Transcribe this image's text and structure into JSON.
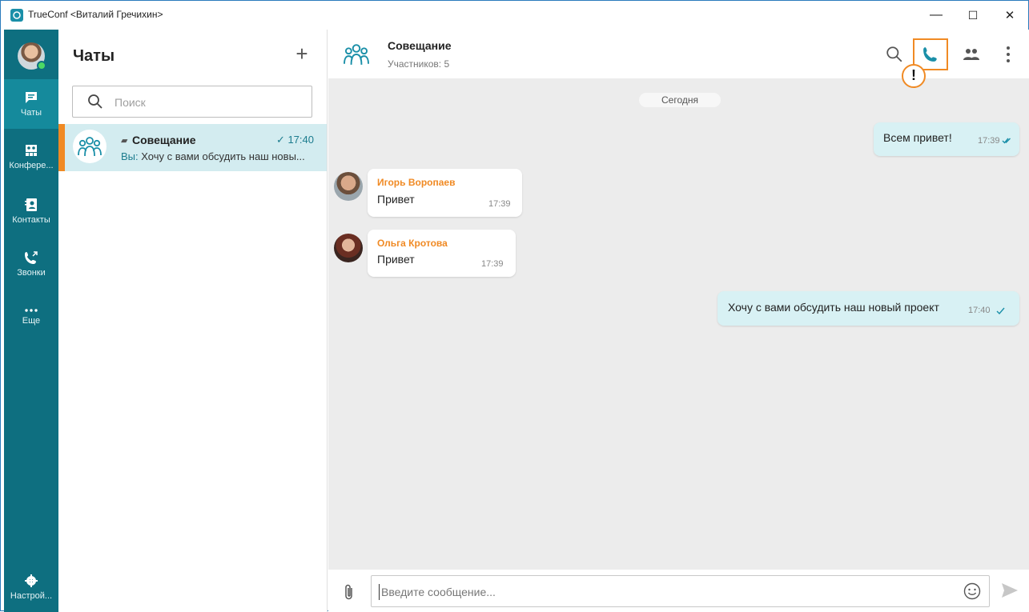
{
  "window": {
    "title": "TrueConf <Виталий Гречихин>",
    "minimize": "—",
    "maximize": "☐",
    "close": "✕"
  },
  "nav": {
    "items": [
      {
        "label": "Чаты",
        "icon": "chat-icon"
      },
      {
        "label": "Конфере...",
        "icon": "conference-icon"
      },
      {
        "label": "Контакты",
        "icon": "contacts-icon"
      },
      {
        "label": "Звонки",
        "icon": "calls-icon"
      },
      {
        "label": "Еще",
        "icon": "more-icon"
      }
    ],
    "settings_label": "Настрой..."
  },
  "chatlist": {
    "title": "Чаты",
    "add_label": "+",
    "search_placeholder": "Поиск",
    "chats": [
      {
        "name": "Совещание",
        "time": "17:40",
        "preview_prefix": "Вы:",
        "preview": " Хочу с вами обсудить наш новы..."
      }
    ]
  },
  "conversation": {
    "name": "Совещание",
    "subtitle": "Участников: 5",
    "date_label": "Сегодня",
    "alert_mark": "!",
    "messages": [
      {
        "direction": "out",
        "text": "Всем привет!",
        "time": "17:39"
      },
      {
        "direction": "in",
        "author": "Игорь Воропаев",
        "text": "Привет",
        "time": "17:39"
      },
      {
        "direction": "in",
        "author": "Ольга Кротова",
        "text": "Привет",
        "time": "17:39"
      },
      {
        "direction": "out",
        "text": "Хочу с вами обсудить наш новый проект",
        "time": "17:40"
      }
    ],
    "composer_placeholder": "Введите сообщение..."
  },
  "colors": {
    "nav_bg": "#0e6f80",
    "accent": "#f08a24",
    "selected_row": "#d3ecf0",
    "outgoing_bubble": "#d8f1f4"
  }
}
